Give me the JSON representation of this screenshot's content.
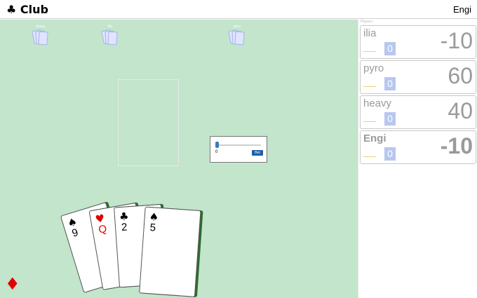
{
  "header": {
    "app_title": "♣ Club",
    "user_name": "Engi"
  },
  "opponents": [
    {
      "name": "heavy"
    },
    {
      "name": "ilia"
    },
    {
      "name": "pyro"
    }
  ],
  "bet_control": {
    "value": "0",
    "button_label": "Bet"
  },
  "hand": [
    {
      "suit": "♠",
      "rank": "9",
      "color": "black"
    },
    {
      "suit": "♥",
      "rank": "Q",
      "color": "red"
    },
    {
      "suit": "♣",
      "rank": "2",
      "color": "black"
    },
    {
      "suit": "♠",
      "rank": "5",
      "color": "black"
    }
  ],
  "trump": {
    "suit": "♦",
    "icon": "diamond-icon",
    "color": "#e00000"
  },
  "sidebar": {
    "players_label": "Players:",
    "players": [
      {
        "name": "ilia",
        "bet": "0",
        "score": "-10"
      },
      {
        "name": "pyro",
        "bet": "0",
        "score": "60"
      },
      {
        "name": "heavy",
        "bet": "0",
        "score": "40"
      },
      {
        "name": "Engi",
        "bet": "0",
        "score": "-10"
      }
    ]
  },
  "colors": {
    "table": "#c2e5cb",
    "card_back": "#dfe4ff",
    "bet_badge": "#b8c7ef",
    "button": "#1d5fa8"
  }
}
